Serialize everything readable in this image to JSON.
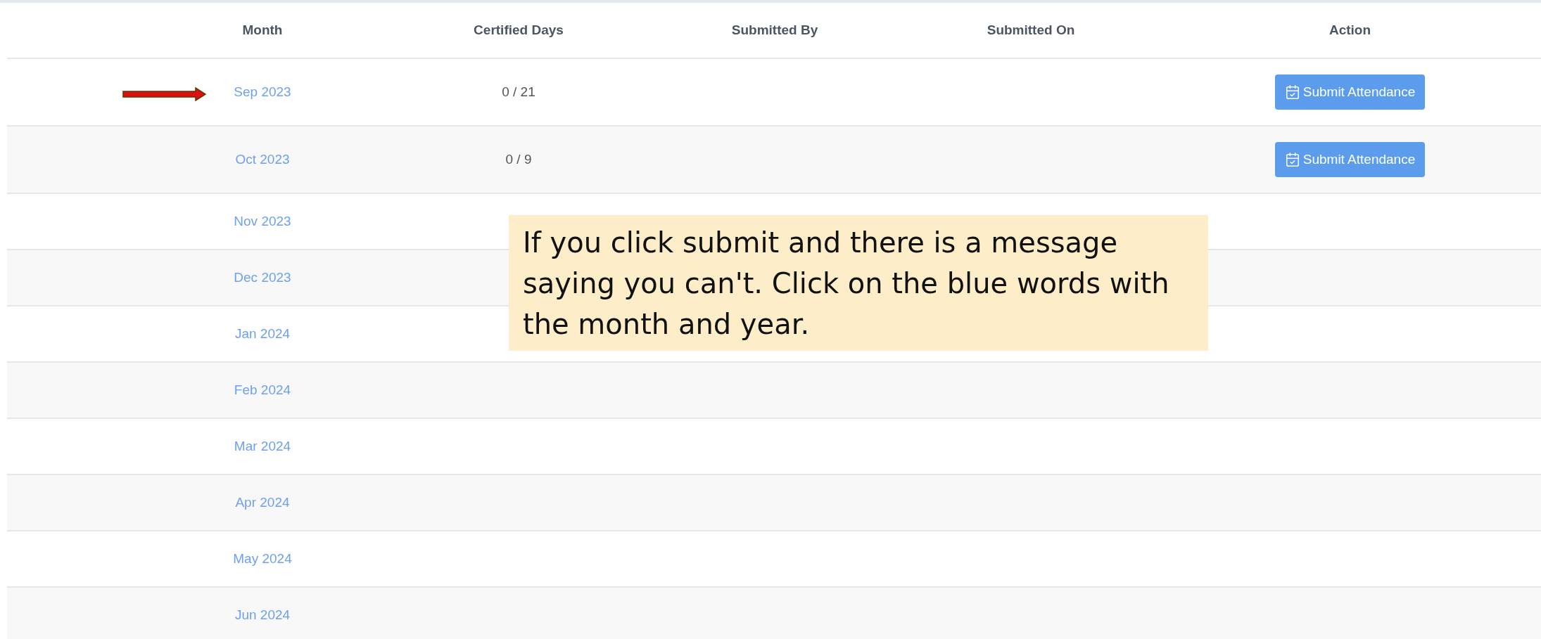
{
  "table": {
    "columns": [
      "Month",
      "Certified Days",
      "Submitted By",
      "Submitted On",
      "Action"
    ],
    "rows": [
      {
        "month": "Sep 2023",
        "certified_days": "0 / 21",
        "action": "Submit Attendance"
      },
      {
        "month": "Oct 2023",
        "certified_days": "0 / 9",
        "action": "Submit Attendance"
      },
      {
        "month": "Nov 2023"
      },
      {
        "month": "Dec 2023"
      },
      {
        "month": "Jan 2024"
      },
      {
        "month": "Feb 2024"
      },
      {
        "month": "Mar 2024"
      },
      {
        "month": "Apr 2024"
      },
      {
        "month": "May 2024"
      },
      {
        "month": "Jun 2024"
      }
    ]
  },
  "callout": {
    "text": "If you click submit and there is a message saying you can't. Click on the blue words with the month and year."
  }
}
